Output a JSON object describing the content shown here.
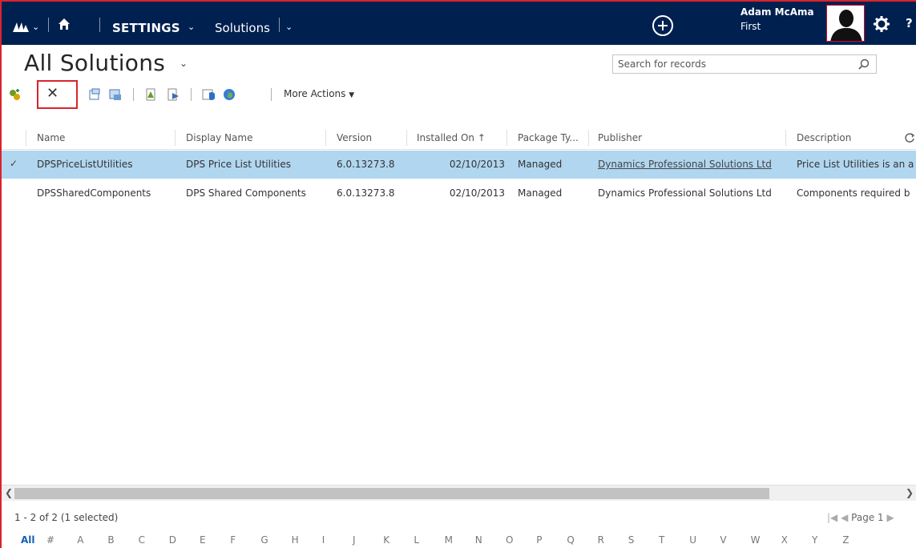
{
  "nav": {
    "area": "SETTINGS",
    "entity": "Solutions",
    "user_name": "Adam McAma",
    "user_org": "First",
    "help": "?"
  },
  "header": {
    "title": "All Solutions",
    "search_placeholder": "Search for records"
  },
  "toolbar": {
    "more_actions": "More Actions"
  },
  "grid": {
    "columns": [
      "Name",
      "Display Name",
      "Version",
      "Installed On",
      "Package Ty...",
      "Publisher",
      "Description"
    ],
    "rows": [
      {
        "name": "DPSPriceListUtilities",
        "display_name": "DPS Price List Utilities",
        "version": "6.0.13273.8",
        "installed_on": "02/10/2013",
        "package_type": "Managed",
        "publisher": "Dynamics Professional Solutions Ltd",
        "description": "Price List Utilities is an a",
        "selected": true
      },
      {
        "name": "DPSSharedComponents",
        "display_name": "DPS Shared Components",
        "version": "6.0.13273.8",
        "installed_on": "02/10/2013",
        "package_type": "Managed",
        "publisher": "Dynamics Professional Solutions Ltd",
        "description": "Components required b",
        "selected": false
      }
    ]
  },
  "footer": {
    "status": "1 - 2 of 2 (1 selected)",
    "page_label": "Page 1",
    "alphabet": [
      "All",
      "#",
      "A",
      "B",
      "C",
      "D",
      "E",
      "F",
      "G",
      "H",
      "I",
      "J",
      "K",
      "L",
      "M",
      "N",
      "O",
      "P",
      "Q",
      "R",
      "S",
      "T",
      "U",
      "V",
      "W",
      "X",
      "Y",
      "Z"
    ]
  },
  "colors": {
    "nav_bg": "#002050",
    "selected_row": "#b1d6f0",
    "highlight_red": "#d9232d",
    "active_letter": "#1160b7"
  },
  "icons": [
    "app-logo-icon",
    "home-icon",
    "add-icon",
    "settings-gear-icon",
    "search-icon",
    "delete-icon",
    "refresh-icon"
  ]
}
